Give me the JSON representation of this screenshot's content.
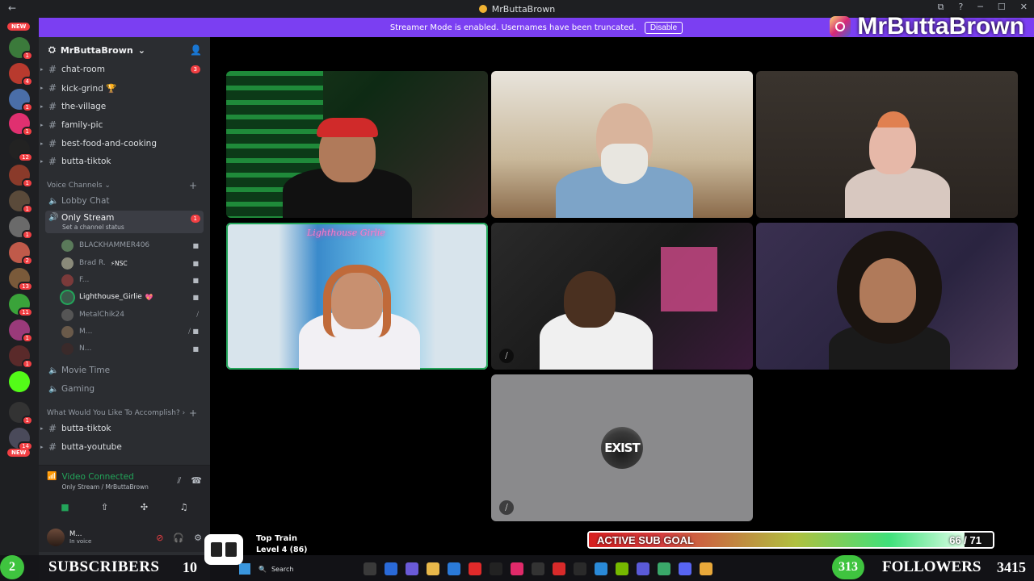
{
  "window": {
    "title": "MrButtaBrown",
    "controls": [
      "⧉",
      "?",
      "─",
      "☐",
      "✕"
    ]
  },
  "banner": {
    "message": "Streamer Mode is enabled. Usernames have been truncated.",
    "disable_label": "Disable",
    "brand_name": "MrButtaBrown"
  },
  "rail": {
    "new_label": "NEW",
    "badges": [
      "1",
      "4",
      "1",
      "1",
      "12",
      "1",
      "1",
      "1",
      "2",
      "13",
      "11",
      "1",
      "1",
      "1",
      "14"
    ]
  },
  "sidebar": {
    "guild_name": "MrButtaBrown",
    "text_channels": [
      {
        "name": "chat-room",
        "badge": "3"
      },
      {
        "name": "kick-grind 🏆"
      },
      {
        "name": "the-village"
      },
      {
        "name": "family-pic"
      },
      {
        "name": "best-food-and-cooking"
      },
      {
        "name": "butta-tiktok"
      }
    ],
    "voice_category": "Voice Channels",
    "voice_channels": [
      {
        "name": "Lobby Chat"
      },
      {
        "name": "Only Stream",
        "status": "Set a channel status",
        "badge": "1"
      }
    ],
    "members": [
      {
        "name": "BLACKHAMMER406"
      },
      {
        "name": "Brad R.",
        "tag": "⚡NSC"
      },
      {
        "name": "F..."
      },
      {
        "name": "Lighthouse_Girlie",
        "suffix": "💖"
      },
      {
        "name": "MetalChik24"
      },
      {
        "name": "M..."
      },
      {
        "name": "N..."
      }
    ],
    "more_voice": [
      {
        "name": "Movie Time"
      },
      {
        "name": "Gaming"
      }
    ],
    "category2": "What Would You Like To Accomplish?",
    "category2_channels": [
      {
        "name": "butta-tiktok"
      },
      {
        "name": "butta-youtube"
      }
    ],
    "voice_panel": {
      "status": "Video Connected",
      "channel": "Only Stream / MrButtaBrown"
    },
    "user": {
      "name": "M...",
      "status": "In voice"
    }
  },
  "stage": {
    "neon_sign": "Lighthouse Girlie",
    "exist_logo": "EXIST"
  },
  "overlay": {
    "sub_goal_label": "ACTIVE SUB GOAL",
    "sub_goal_current": 66,
    "sub_goal_target": 71,
    "sub_goal_text": "66 / 71",
    "top_train_title": "Top Train",
    "top_train_level": "Level 4  (86)",
    "subscribers_label": "SUBSCRIBERS",
    "subscribers_pill": "2",
    "subscribers_count": "10",
    "followers_label": "FOLLOWERS",
    "followers_pill": "313",
    "followers_count": "3415",
    "taskbar_search": "Search"
  },
  "colors": {
    "banner": "#7b3ff2",
    "online": "#23a55a",
    "notify": "#f23f43"
  }
}
